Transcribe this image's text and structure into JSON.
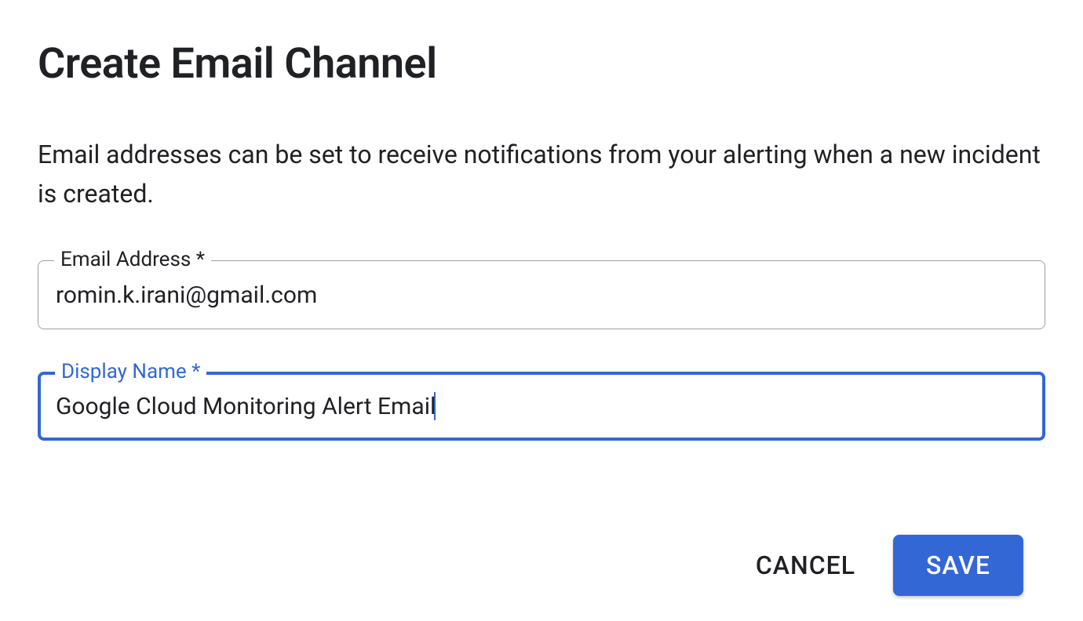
{
  "dialog": {
    "title": "Create Email Channel",
    "description": "Email addresses can be set to receive notifications from your alerting when a new incident is created.",
    "fields": {
      "email": {
        "label": "Email Address *",
        "value": "romin.k.irani@gmail.com"
      },
      "displayName": {
        "label": "Display Name *",
        "value": "Google Cloud Monitoring Alert Email"
      }
    },
    "actions": {
      "cancel": "CANCEL",
      "save": "SAVE"
    }
  }
}
